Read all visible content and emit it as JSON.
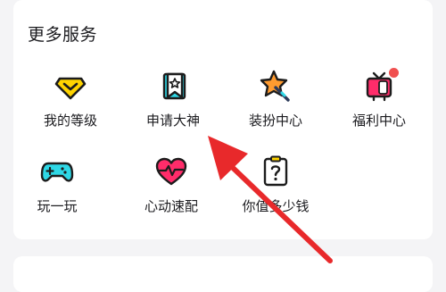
{
  "section": {
    "title": "更多服务"
  },
  "services": [
    {
      "label": "我的等级",
      "icon": "diamond-level-icon"
    },
    {
      "label": "申请大神",
      "icon": "bookmark-star-icon"
    },
    {
      "label": "装扮中心",
      "icon": "star-wand-icon"
    },
    {
      "label": "福利中心",
      "icon": "gift-tv-icon",
      "badge": "red-dot"
    },
    {
      "label": "玩一玩",
      "icon": "gamepad-icon"
    },
    {
      "label": "心动速配",
      "icon": "heartbeat-icon"
    },
    {
      "label": "你值多少钱",
      "icon": "question-clipboard-icon"
    }
  ],
  "colors": {
    "outline": "#1c1c1c",
    "yellow": "#ffd400",
    "cyan": "#2ed8e6",
    "pink": "#ff2c6a",
    "orange": "#ff9b2f",
    "badge": "#f05050",
    "arrow": "#e8292b"
  }
}
